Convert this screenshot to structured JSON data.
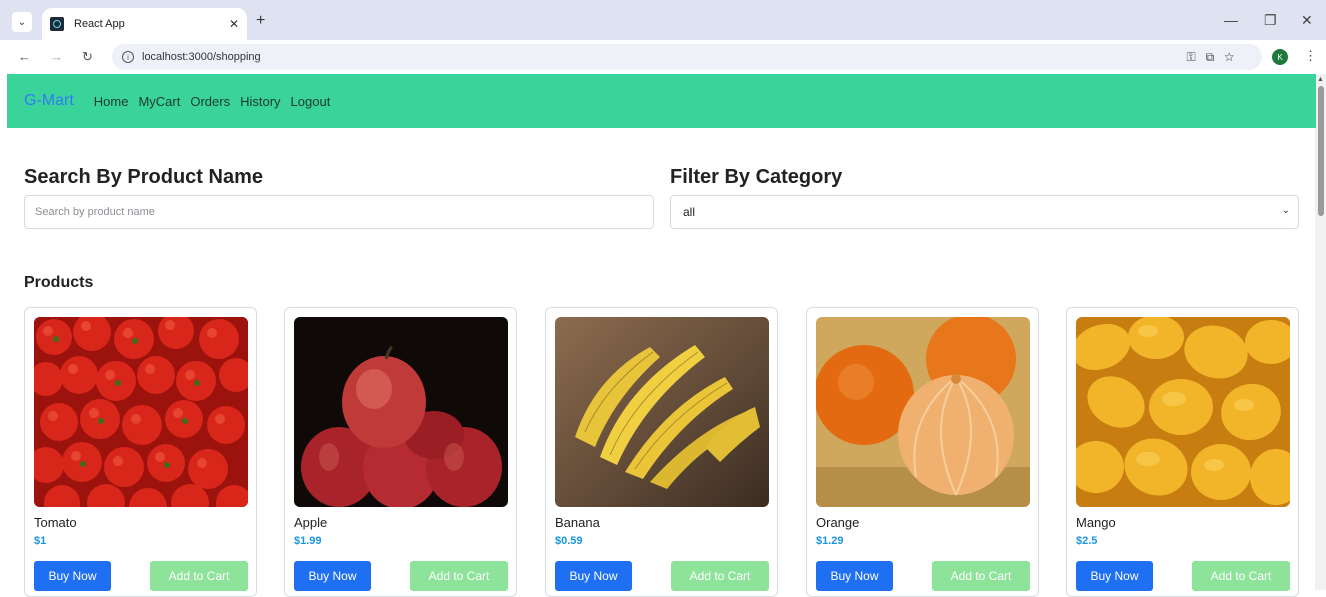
{
  "browser": {
    "tab_title": "React App",
    "url": "localhost:3000/shopping",
    "avatar_letter": "K"
  },
  "navbar": {
    "brand": "G-Mart",
    "links": [
      "Home",
      "MyCart",
      "Orders",
      "History",
      "Logout"
    ]
  },
  "search": {
    "title": "Search By Product Name",
    "placeholder": "Search by product name"
  },
  "filter": {
    "title": "Filter By Category",
    "selected": "all"
  },
  "products": {
    "title": "Products",
    "buy_label": "Buy Now",
    "cart_label": "Add to Cart",
    "items": [
      {
        "name": "Tomato",
        "price": "$1"
      },
      {
        "name": "Apple",
        "price": "$1.99"
      },
      {
        "name": "Banana",
        "price": "$0.59"
      },
      {
        "name": "Orange",
        "price": "$1.29"
      },
      {
        "name": "Mango",
        "price": "$2.5"
      }
    ]
  },
  "colors": {
    "navbar_bg": "#3ad49a",
    "brand": "#2f7cf0",
    "buy_button": "#1f6ff2",
    "cart_button": "#8ee39b",
    "price": "#1b95e0"
  }
}
